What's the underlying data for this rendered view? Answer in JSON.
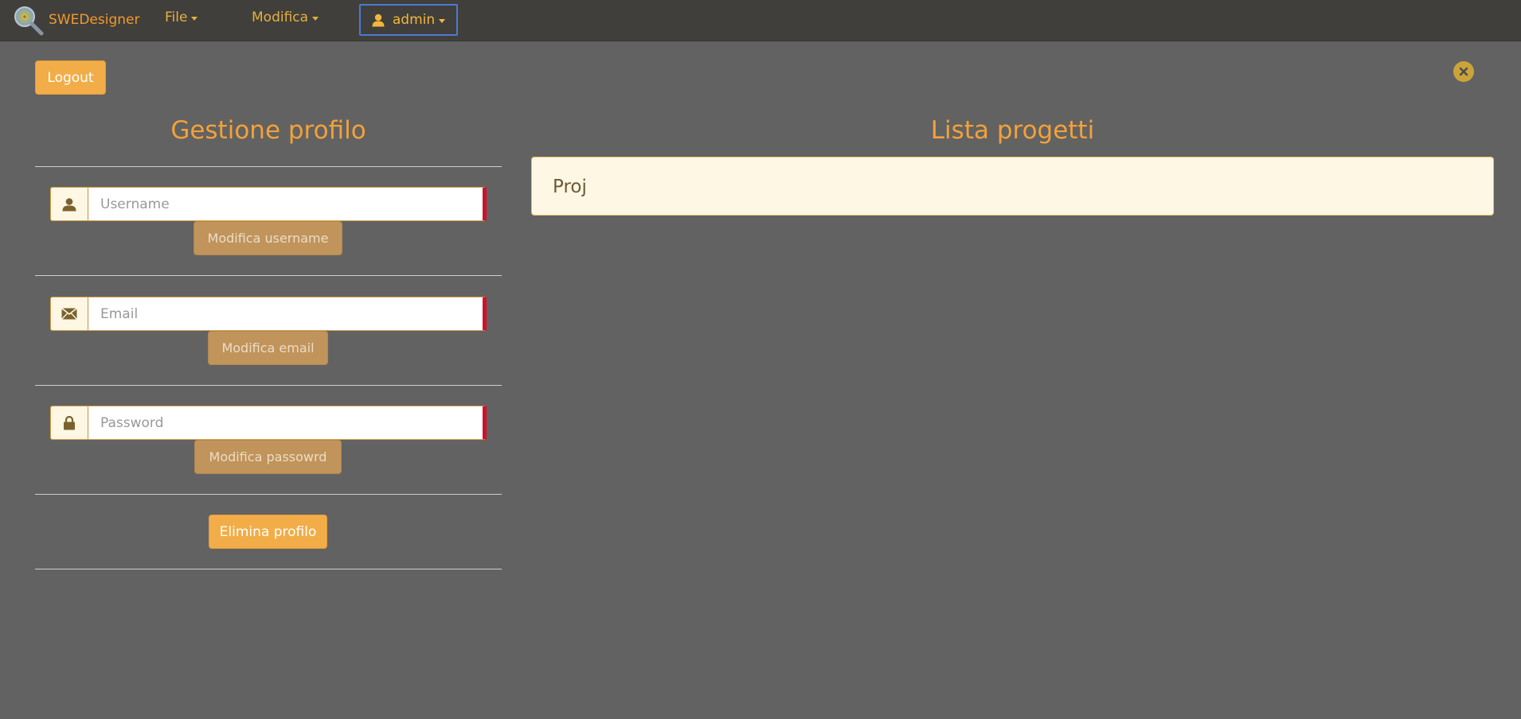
{
  "navbar": {
    "brand": "SWEDesigner",
    "menus": [
      {
        "label": "File"
      },
      {
        "label": "Modifica"
      }
    ],
    "user": {
      "label": "admin"
    }
  },
  "actions": {
    "logout_label": "Logout"
  },
  "profile": {
    "title": "Gestione profilo",
    "username": {
      "placeholder": "Username",
      "value": "",
      "button": "Modifica username"
    },
    "email": {
      "placeholder": "Email",
      "value": "",
      "button": "Modifica email"
    },
    "password": {
      "placeholder": "Password",
      "value": "",
      "button": "Modifica passowrd"
    },
    "delete_button": "Elimina profilo"
  },
  "projects": {
    "title": "Lista progetti",
    "items": [
      {
        "name": "Proj"
      }
    ]
  },
  "colors": {
    "background": "#626262",
    "navbar": "#403f3b",
    "accent": "#f2ad48",
    "heading": "#f3a13a",
    "invalid_border": "#d0112b"
  },
  "icons": {
    "brand": "magnifier-gear-icon",
    "user": "user-icon",
    "envelope": "envelope-icon",
    "lock": "lock-icon",
    "close": "close-icon"
  }
}
